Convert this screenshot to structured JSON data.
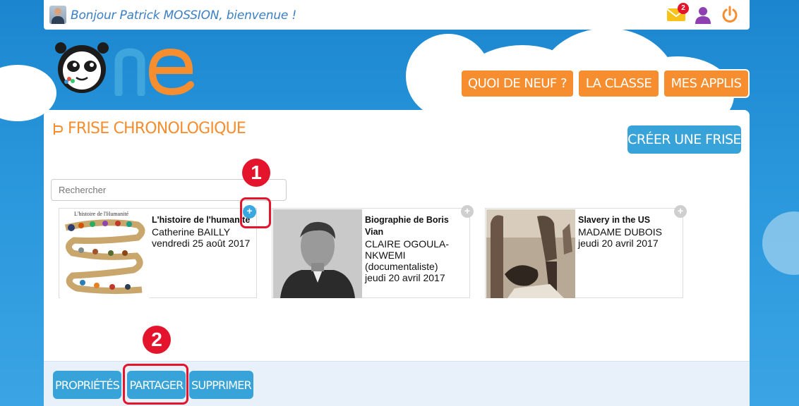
{
  "topbar": {
    "greeting": "Bonjour Patrick MOSSION, bienvenue !",
    "mail_badge": "2",
    "icons": [
      "mail-icon",
      "user-icon",
      "power-icon"
    ]
  },
  "brand": {
    "logo_text": "one"
  },
  "nav": {
    "news": "QUOI DE NEUF ?",
    "class": "LA CLASSE",
    "apps": "MES APPLIS"
  },
  "page": {
    "title": "FRISE CHRONOLOGIQUE",
    "create_button": "CRÉER UNE FRISE",
    "search_placeholder": "Rechercher"
  },
  "timelines": [
    {
      "title": "L'histoire de l'humanité",
      "author": "Catherine BAILLY",
      "date": "vendredi 25 août 2017",
      "thumb_caption": "L'histoire de l'Humanité"
    },
    {
      "title": "Biographie de Boris Vian",
      "author": "CLAIRE OGOULA-NKWEMI (documentaliste)",
      "date": "jeudi 20 avril 2017"
    },
    {
      "title": "Slavery in the US",
      "author": "MADAME DUBOIS",
      "date": "jeudi 20 avril 2017"
    }
  ],
  "markers": {
    "one": "1",
    "two": "2"
  },
  "footer": {
    "properties": "PROPRIÉTÉS",
    "share": "PARTAGER",
    "delete": "SUPPRIMER"
  },
  "colors": {
    "accent_orange": "#f68d2e",
    "button_blue": "#37a3d8",
    "highlight_red": "#e3142b"
  }
}
